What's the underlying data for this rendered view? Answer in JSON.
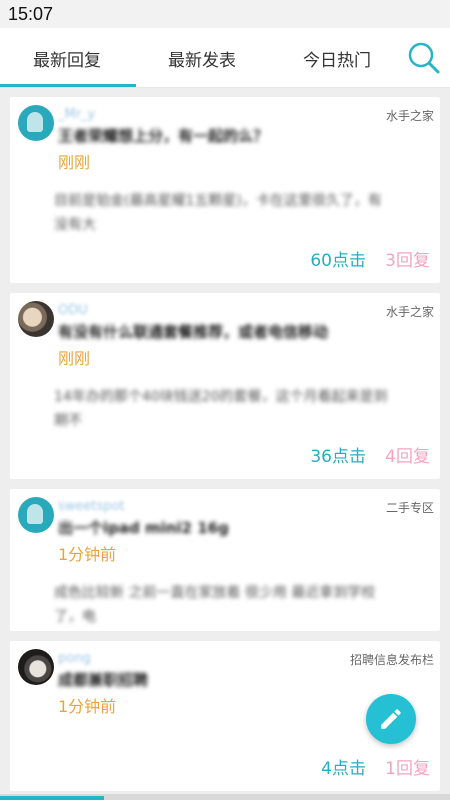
{
  "status_bar": {
    "time": "15:07"
  },
  "tabs": [
    {
      "label": "最新回复",
      "active": true
    },
    {
      "label": "最新发表",
      "active": false
    },
    {
      "label": "今日热门",
      "active": false
    }
  ],
  "accent_color": "#26b5c6",
  "search_icon": "search-icon",
  "posts": [
    {
      "username": "_Mr_y",
      "forum": "水手之家",
      "title": "王者荣耀想上分，有一起的么？",
      "time": "刚刚",
      "body": "目前是铂金(最高星耀1五颗星)，卡在这里很久了，有没有大",
      "clicks": "60点击",
      "replies": "3回复"
    },
    {
      "username": "ODU",
      "forum": "水手之家",
      "title": "有没有什么联通套餐推荐，或者电信移动",
      "time": "刚刚",
      "body": "14年办的那个40块钱送20的套餐，这个月看起来是到期不",
      "clicks": "36点击",
      "replies": "4回复"
    },
    {
      "username": "sweetspot",
      "forum": "二手专区",
      "title": "出一个ipad mini2 16g",
      "time": "1分钟前",
      "body": "成色比较新 之前一直在家放着 很少用 最近拿到学校了，电",
      "clicks": "",
      "replies": ""
    },
    {
      "username": "pong",
      "forum": "招聘信息发布栏",
      "title": "成都兼职招聘",
      "time": "1分钟前",
      "body": "",
      "clicks": "4点击",
      "replies": "1回复"
    }
  ],
  "fab": {
    "icon": "edit-pencil-icon"
  }
}
